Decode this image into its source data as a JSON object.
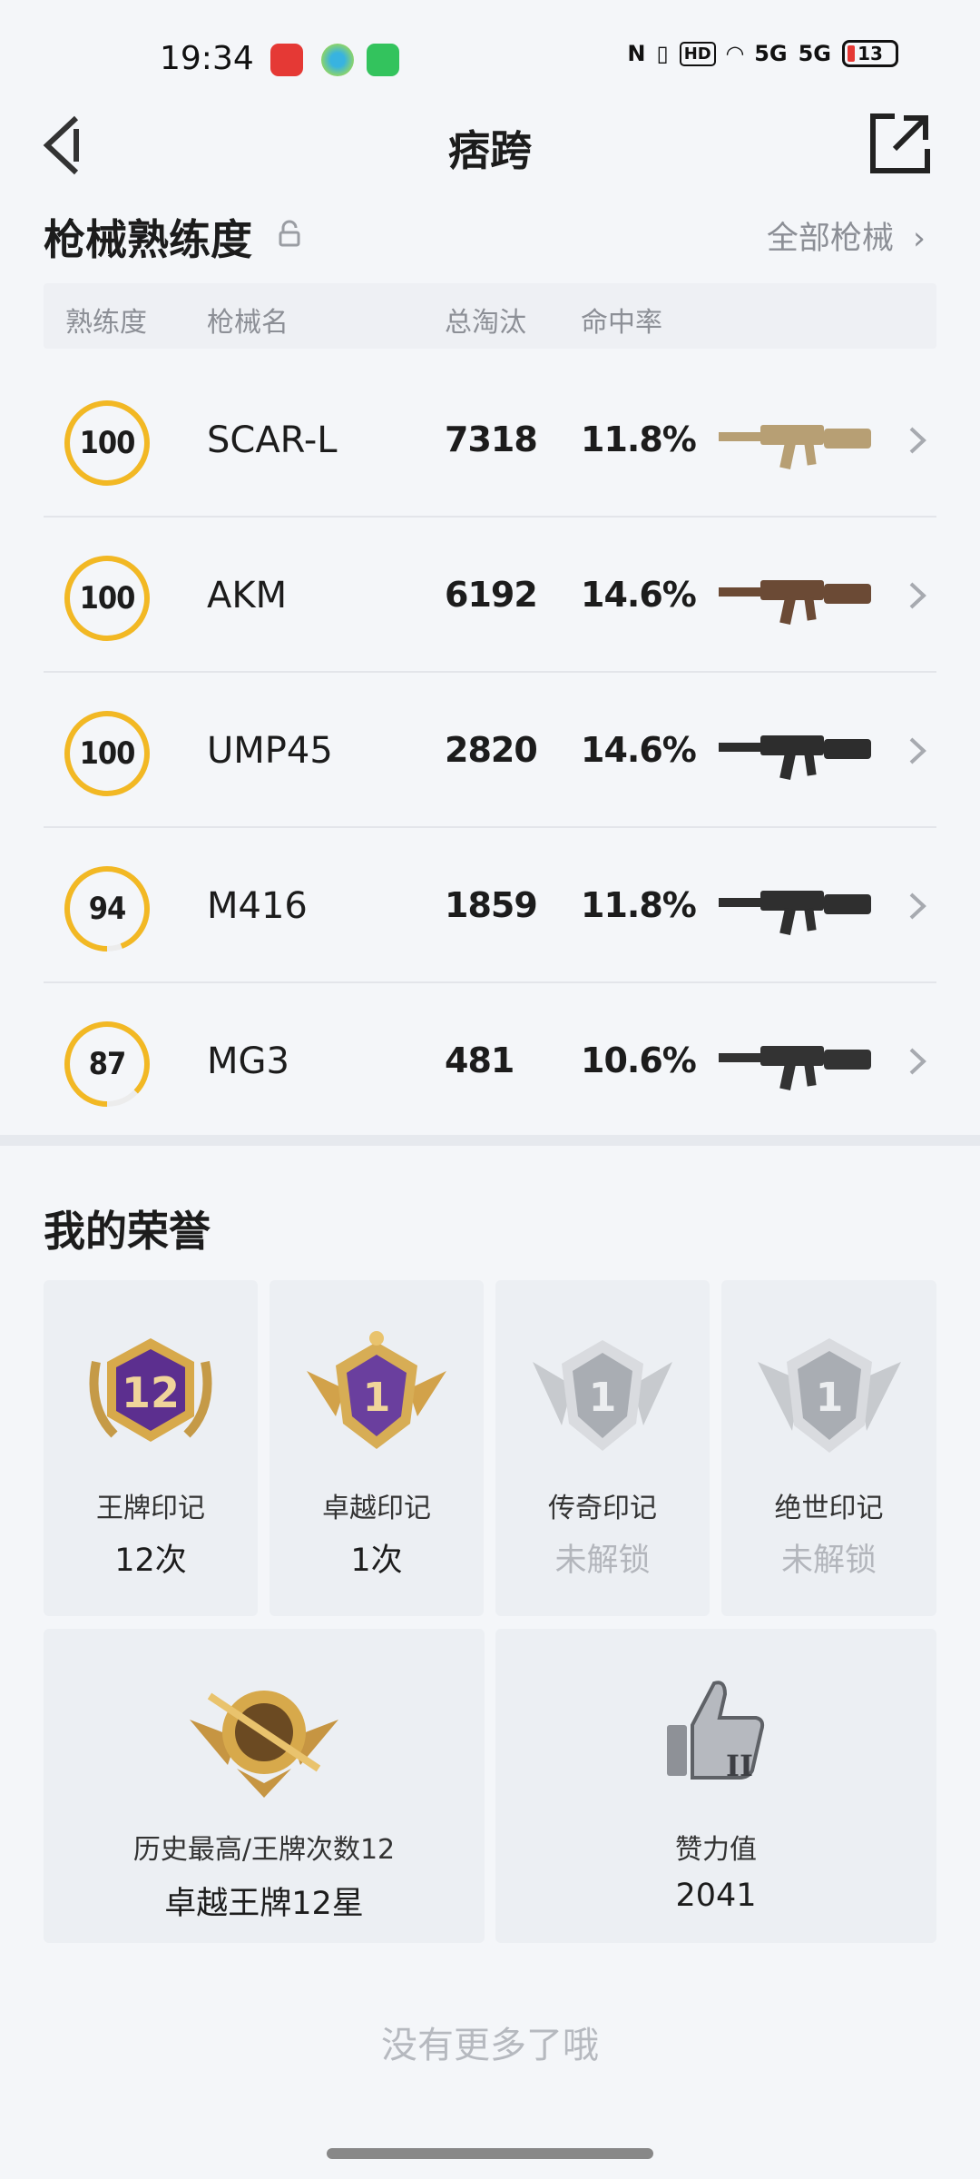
{
  "status": {
    "time": "19:34",
    "hd_label": "HD",
    "net1": "5G",
    "net2": "5G",
    "battery": "13"
  },
  "nav": {
    "title": "痞跨"
  },
  "mastery": {
    "title": "枪械熟练度",
    "all_link": "全部枪械",
    "headers": {
      "proficiency": "熟练度",
      "name": "枪械名",
      "kills": "总淘汰",
      "hit_rate": "命中率"
    },
    "rows": [
      {
        "proficiency": "100",
        "percent": 100,
        "name": "SCAR-L",
        "kills": "7318",
        "hit_rate": "11.8%",
        "gun": "scar-l-rifle-image",
        "gun_color": "#b79f74"
      },
      {
        "proficiency": "100",
        "percent": 100,
        "name": "AKM",
        "kills": "6192",
        "hit_rate": "14.6%",
        "gun": "akm-rifle-image",
        "gun_color": "#6b4a35"
      },
      {
        "proficiency": "100",
        "percent": 100,
        "name": "UMP45",
        "kills": "2820",
        "hit_rate": "14.6%",
        "gun": "ump45-smg-image",
        "gun_color": "#2d2d2d"
      },
      {
        "proficiency": "94",
        "percent": 94,
        "name": "M416",
        "kills": "1859",
        "hit_rate": "11.8%",
        "gun": "m416-rifle-image",
        "gun_color": "#2f2f2f"
      },
      {
        "proficiency": "87",
        "percent": 87,
        "name": "MG3",
        "kills": "481",
        "hit_rate": "10.6%",
        "gun": "mg3-lmg-image",
        "gun_color": "#333333"
      }
    ]
  },
  "honors": {
    "title": "我的荣誉",
    "cards": [
      {
        "label": "王牌印记",
        "value": "12次",
        "badge_number": "12",
        "locked": false
      },
      {
        "label": "卓越印记",
        "value": "1次",
        "badge_number": "1",
        "locked": false
      },
      {
        "label": "传奇印记",
        "value": "未解锁",
        "badge_number": "1",
        "locked": true
      },
      {
        "label": "绝世印记",
        "value": "未解锁",
        "badge_number": "1",
        "locked": true
      }
    ],
    "wide_cards": [
      {
        "label": "历史最高/王牌次数12",
        "value": "卓越王牌12星"
      },
      {
        "label": "赞力值",
        "value": "2041",
        "badge_text": "II"
      }
    ]
  },
  "footer": {
    "no_more": "没有更多了哦"
  },
  "colors": {
    "ring": "#f2b824",
    "ring_track": "#ececec",
    "gold": "#d8a84a",
    "purple": "#6a3f9e",
    "silver": "#c3c6cc"
  }
}
